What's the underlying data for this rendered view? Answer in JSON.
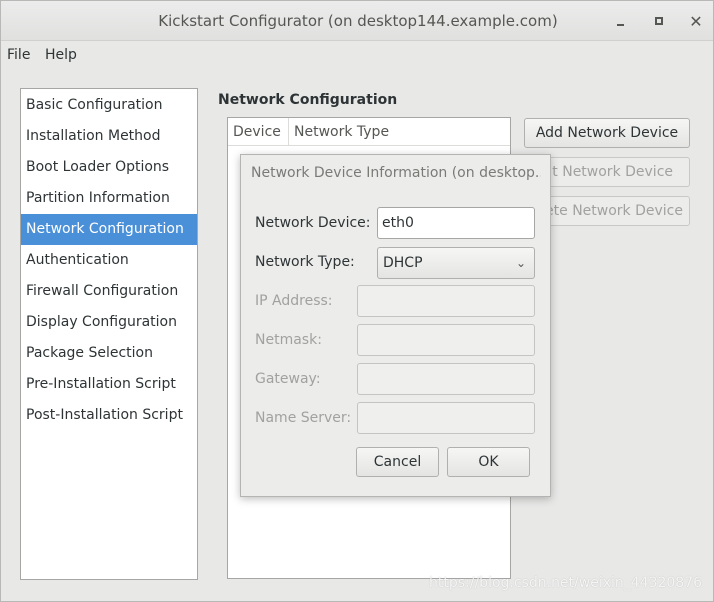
{
  "window": {
    "title": "Kickstart Configurator (on desktop144.example.com)",
    "minimize_glyph": "",
    "close_glyph": "✕"
  },
  "menu": {
    "file": "File",
    "help": "Help"
  },
  "sidebar": {
    "items": [
      {
        "label": "Basic Configuration"
      },
      {
        "label": "Installation Method"
      },
      {
        "label": "Boot Loader Options"
      },
      {
        "label": "Partition Information"
      },
      {
        "label": "Network Configuration"
      },
      {
        "label": "Authentication"
      },
      {
        "label": "Firewall Configuration"
      },
      {
        "label": "Display Configuration"
      },
      {
        "label": "Package Selection"
      },
      {
        "label": "Pre-Installation Script"
      },
      {
        "label": "Post-Installation Script"
      }
    ],
    "selected": "Network Configuration"
  },
  "main": {
    "section_title": "Network Configuration",
    "table_headers": [
      "Device",
      "Network Type"
    ],
    "buttons": {
      "add": "Add Network Device",
      "edit": "dit Network Device",
      "delete": "ete Network Device"
    }
  },
  "dialog": {
    "title": "Network Device Information (on desktop...",
    "fields": {
      "device_label": "Network Device:",
      "device_value": "eth0",
      "type_label": "Network Type:",
      "type_value": "DHCP",
      "ip_label": "IP Address:",
      "netmask_label": "Netmask:",
      "gateway_label": "Gateway:",
      "nameserver_label": "Name Server:"
    },
    "cancel": "Cancel",
    "ok": "OK"
  },
  "watermark": "https://blog.csdn.net/weixin_44320876",
  "colors": {
    "selection": "#4a90d9",
    "window_bg": "#e8e8e7"
  }
}
